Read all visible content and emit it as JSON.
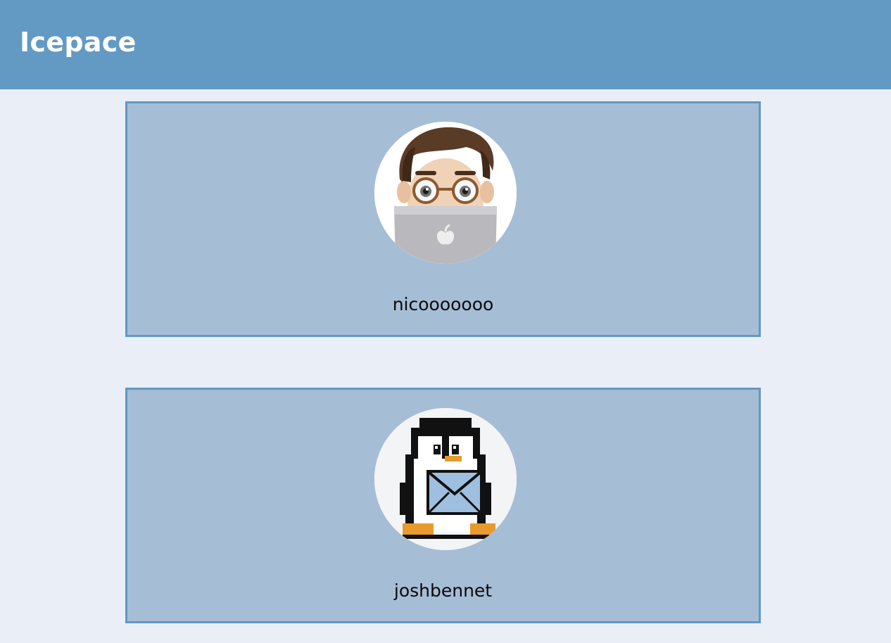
{
  "header": {
    "brand": "Icepace",
    "background": "#629ac4"
  },
  "users": [
    {
      "username": "nicooooooo",
      "avatar_icon": "memoji-laptop-avatar-icon"
    },
    {
      "username": "joshbennet",
      "avatar_icon": "pixel-penguin-envelope-avatar-icon"
    }
  ],
  "colors": {
    "page_background": "#eaeef6",
    "card_background": "#a6bdd6",
    "card_border": "#6199c4"
  }
}
